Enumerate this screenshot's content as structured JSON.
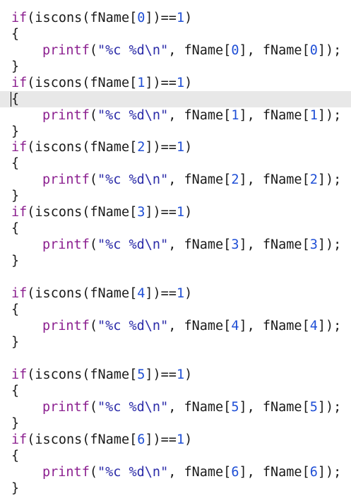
{
  "editor": {
    "indices": [
      "0",
      "1",
      "2",
      "3",
      "4",
      "5",
      "6"
    ],
    "tokens": {
      "if": "if",
      "iscons": "(iscons(",
      "fname": "fName",
      "lbr": "[",
      "rbr": "]",
      "eq": ")==",
      "one": "1",
      "close": ")",
      "open_brace": "{",
      "close_brace": "}",
      "printf": "printf",
      "paren_open": "(",
      "fmt": "\"%c %d\\n\"",
      "comma": ", ",
      "end": ");"
    },
    "current_line_index": 1
  },
  "colors": {
    "keyword": "#8b1f8f",
    "string": "#2b2ba8",
    "number": "#1f4fd6",
    "text": "#1a1a1a",
    "current_line": "#e8e8e8"
  }
}
